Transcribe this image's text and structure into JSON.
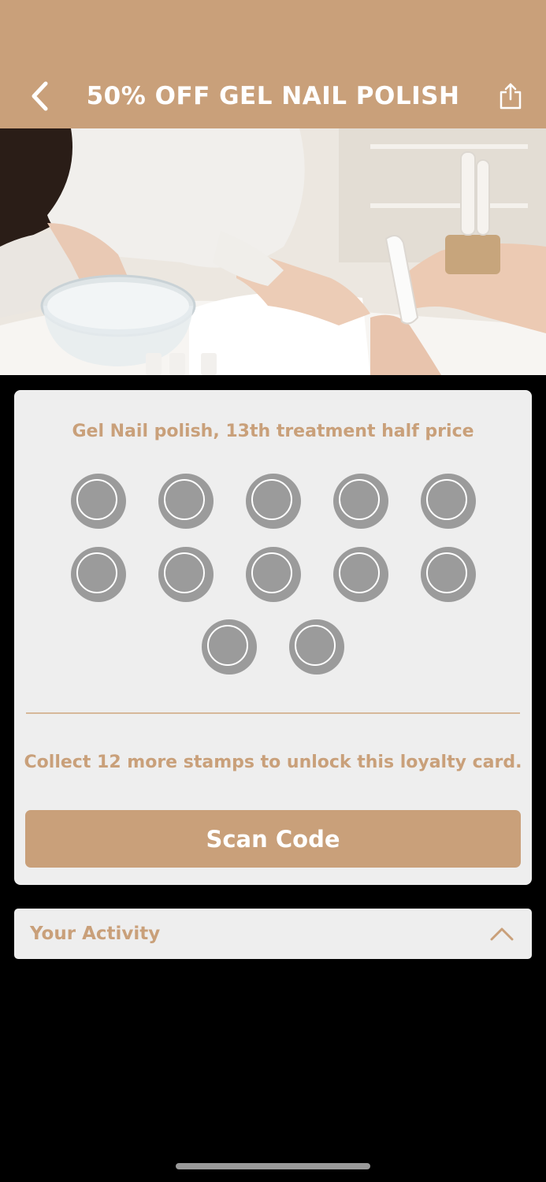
{
  "header": {
    "title": "50% OFF GEL NAIL POLISH",
    "back_icon": "chevron-left-icon",
    "share_icon": "share-icon",
    "background_color": "#c9a07a"
  },
  "hero": {
    "image_description": "manicure-salon-photo"
  },
  "card": {
    "subtitle": "Gel Nail polish, 13th treatment half price",
    "stamps_total": 12,
    "stamps_collected": 0,
    "unlock_text": "Collect 12 more stamps to unlock this loyalty card.",
    "scan_button_label": "Scan Code",
    "accent_color": "#c9a07a",
    "stamp_color": "#9b9b9b"
  },
  "activity": {
    "label": "Your Activity",
    "chevron_icon": "chevron-up-icon"
  }
}
